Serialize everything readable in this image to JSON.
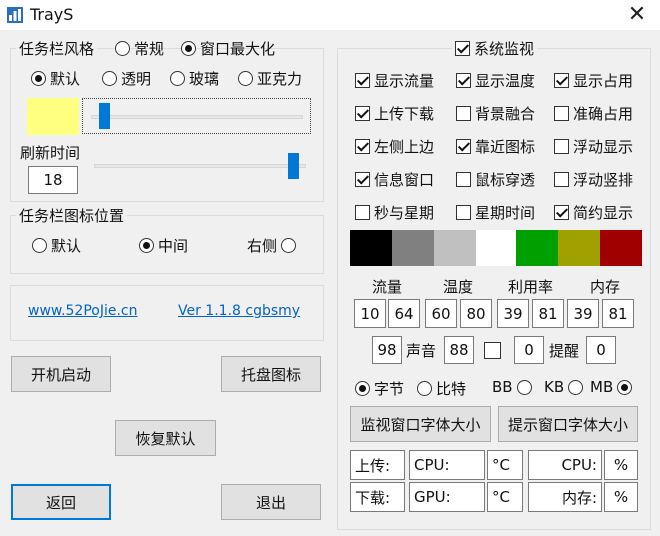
{
  "window": {
    "title": "TrayS"
  },
  "icons": {
    "app": "trays-app-icon",
    "close": "close-icon"
  },
  "style_group": {
    "title": "任务栏风格",
    "mode_options": [
      {
        "label": "常规",
        "selected": false
      },
      {
        "label": "窗口最大化",
        "selected": true
      }
    ],
    "effect_options": [
      {
        "label": "默认",
        "selected": true
      },
      {
        "label": "透明",
        "selected": false
      },
      {
        "label": "玻璃",
        "selected": false
      },
      {
        "label": "亚克力",
        "selected": false
      }
    ],
    "color": "#ffff80",
    "transparency_slider": {
      "value": 0.03
    },
    "refresh_label": "刷新时间",
    "refresh_value": "18",
    "refresh_slider": {
      "value": 1.0
    }
  },
  "position_group": {
    "title": "任务栏图标位置",
    "options": [
      {
        "label": "默认",
        "selected": false
      },
      {
        "label": "中间",
        "selected": true
      },
      {
        "label": "右侧",
        "selected": false
      }
    ]
  },
  "links": {
    "site": "www.52PoJie.cn",
    "version": "Ver 1.1.8 cgbsmy"
  },
  "buttons": {
    "autostart": "开机启动",
    "tray_icon": "托盘图标",
    "restore": "恢复默认",
    "back": "返回",
    "exit": "退出",
    "monitor_font": "监视窗口字体大小",
    "tip_font": "提示窗口字体大小"
  },
  "monitor": {
    "title": "系统监视",
    "title_checked": true,
    "options": [
      {
        "label": "显示流量",
        "checked": true
      },
      {
        "label": "显示温度",
        "checked": true
      },
      {
        "label": "显示占用",
        "checked": true
      },
      {
        "label": "上传下载",
        "checked": true
      },
      {
        "label": "背景融合",
        "checked": false
      },
      {
        "label": "准确占用",
        "checked": false
      },
      {
        "label": "左侧上边",
        "checked": true
      },
      {
        "label": "靠近图标",
        "checked": true
      },
      {
        "label": "浮动显示",
        "checked": false
      },
      {
        "label": "信息窗口",
        "checked": true
      },
      {
        "label": "鼠标穿透",
        "checked": false
      },
      {
        "label": "浮动竖排",
        "checked": false
      },
      {
        "label": "秒与星期",
        "checked": false
      },
      {
        "label": "星期时间",
        "checked": false
      },
      {
        "label": "简约显示",
        "checked": true
      }
    ],
    "colors": [
      "#000000",
      "#808080",
      "#c0c0c0",
      "#ffffff",
      "#00a000",
      "#a0a000",
      "#a00000"
    ],
    "headers": [
      "流量",
      "温度",
      "利用率",
      "内存"
    ],
    "thresholds": [
      "10",
      "64",
      "60",
      "80",
      "39",
      "81",
      "39",
      "81"
    ],
    "sound_value": "98",
    "sound_label": "声音",
    "sound_value2": "88",
    "sound_checked": false,
    "remind_value": "0",
    "remind_label": "提醒",
    "remind_value2": "0",
    "unit_options": [
      {
        "label": "字节",
        "selected": true
      },
      {
        "label": "比特",
        "selected": false
      }
    ],
    "size_options": [
      {
        "label": "BB",
        "selected": false
      },
      {
        "label": "KB",
        "selected": false
      },
      {
        "label": "MB",
        "selected": true
      }
    ],
    "templates": {
      "upload": "上传:",
      "cpu_temp": "CPU:",
      "temp_unit1": "°C",
      "cpu_usage": "CPU:",
      "pct1": "%",
      "download": "下载:",
      "gpu_temp": "GPU:",
      "temp_unit2": "°C",
      "mem_usage": "内存:",
      "pct2": "%"
    }
  }
}
